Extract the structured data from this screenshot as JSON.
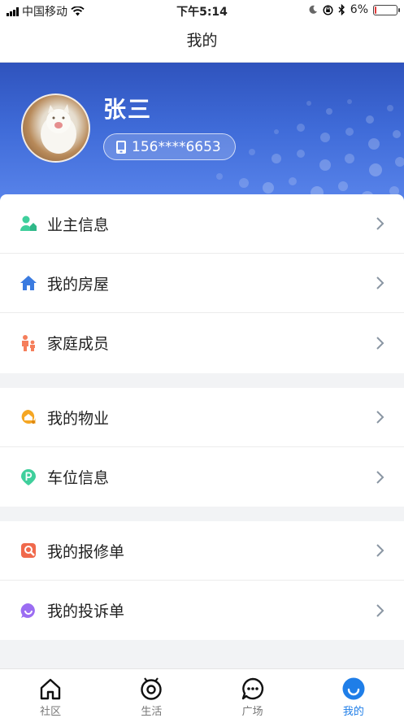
{
  "status_bar": {
    "carrier": "中国移动",
    "time": "下午5:14",
    "battery": "6%",
    "battery_level": 0.06
  },
  "navbar": {
    "title": "我的"
  },
  "profile": {
    "name": "张三",
    "phone": "156****6653"
  },
  "groups": [
    {
      "items": [
        {
          "label": "业主信息",
          "icon": "owner-icon",
          "color": "#3fcf9c"
        },
        {
          "label": "我的房屋",
          "icon": "house-icon",
          "color": "#3b7be0"
        },
        {
          "label": "家庭成员",
          "icon": "family-icon",
          "color": "#f57e5b"
        }
      ]
    },
    {
      "items": [
        {
          "label": "我的物业",
          "icon": "property-icon",
          "color": "#f5a623"
        },
        {
          "label": "车位信息",
          "icon": "parking-icon",
          "color": "#3fcf9c"
        }
      ]
    },
    {
      "items": [
        {
          "label": "我的报修单",
          "icon": "repair-icon",
          "color": "#f0694c"
        },
        {
          "label": "我的投诉单",
          "icon": "complaint-icon",
          "color": "#9b6df2"
        }
      ]
    }
  ],
  "tabs": [
    {
      "label": "社区",
      "icon": "community-icon",
      "active": false
    },
    {
      "label": "生活",
      "icon": "life-icon",
      "active": false
    },
    {
      "label": "广场",
      "icon": "square-icon",
      "active": false
    },
    {
      "label": "我的",
      "icon": "mine-icon",
      "active": true
    }
  ],
  "colors": {
    "accent": "#1f7ee8",
    "header_gradient": [
      "#2f53bd",
      "#5b86ec"
    ]
  }
}
